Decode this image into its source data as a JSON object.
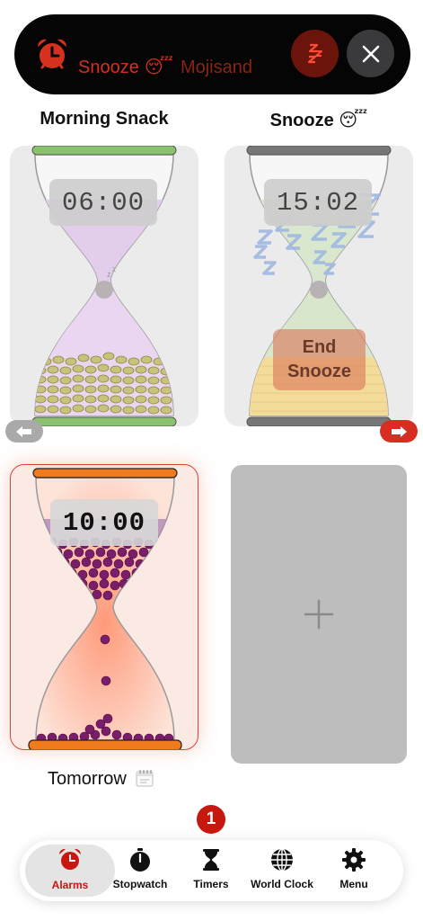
{
  "banner": {
    "title": "Snooze",
    "title_emoji": "😴",
    "subtitle": "Mojisand",
    "snooze_glyph": "zzz",
    "accent_color": "#d6301f"
  },
  "alarms": [
    {
      "title": "Morning Snack",
      "time": "06:00",
      "sand_color": "#c9c27a"
    },
    {
      "title": "Snooze 😴",
      "time": "15:02",
      "action_label_line1": "End",
      "action_label_line2": "Snooze",
      "sand_color": "#f3dc9a"
    },
    {
      "time": "10:00",
      "label": "Tomorrow",
      "label_icon": "calendar-icon",
      "sand_color": "#7a1d6a"
    }
  ],
  "add_card": {
    "icon": "plus-icon"
  },
  "badge": {
    "count": "1"
  },
  "tabs": [
    {
      "label": "Alarms",
      "icon": "alarm-clock-icon",
      "active": true
    },
    {
      "label": "Stopwatch",
      "icon": "stopwatch-icon",
      "active": false
    },
    {
      "label": "Timers",
      "icon": "hourglass-icon",
      "active": false
    },
    {
      "label": "World Clock",
      "icon": "globe-icon",
      "active": false
    },
    {
      "label": "Menu",
      "icon": "gear-icon",
      "active": false
    }
  ]
}
